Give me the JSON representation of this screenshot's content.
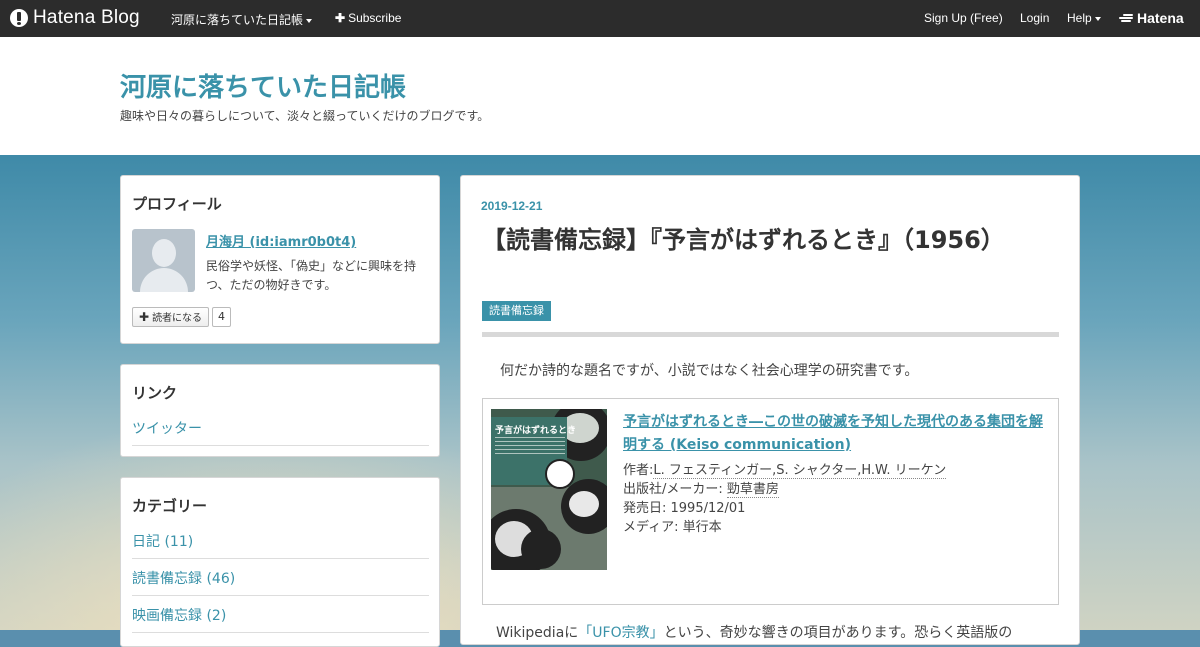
{
  "topbar": {
    "logo": "Hatena Blog",
    "blog_menu": "河原に落ちていた日記帳",
    "subscribe": "Subscribe",
    "signup": "Sign Up (Free)",
    "login": "Login",
    "help": "Help",
    "hatena": "Hatena"
  },
  "header": {
    "title": "河原に落ちていた日記帳",
    "description": "趣味や日々の暮らしについて、淡々と綴っていくだけのブログです。"
  },
  "profile": {
    "heading": "プロフィール",
    "name": "月海月 (id:iamr0b0t4)",
    "bio": "民俗学や妖怪、「偽史」などに興味を持つ、ただの物好きです。",
    "reader_button": "読者になる",
    "reader_count": "4"
  },
  "links": {
    "heading": "リンク",
    "items": [
      {
        "label": "ツイッター"
      }
    ]
  },
  "categories": {
    "heading": "カテゴリー",
    "items": [
      {
        "label": "日記 (11)"
      },
      {
        "label": "読書備忘録 (46)"
      },
      {
        "label": "映画備忘録 (2)"
      }
    ]
  },
  "article": {
    "date": "2019-12-21",
    "title": "【読書備忘録】『予言がはずれるとき』（1956）",
    "tag": "読書備忘録",
    "lead": "何だか詩的な題名ですが、小説ではなく社会心理学の研究書です。",
    "product": {
      "cover_title": "予言がはずれるとき",
      "link": "予言がはずれるとき―この世の破滅を予知した現代のある集団を解明する (Keiso communication)",
      "author_label": "作者:",
      "author": "L. フェスティンガー,S. シャクター,H.W. リーケン",
      "publisher_label": "出版社/メーカー:",
      "publisher": "勁草書房",
      "release": "発売日: 1995/12/01",
      "media": "メディア: 単行本"
    },
    "body_prefix": "Wikipediaに",
    "body_link": "「UFO宗教」",
    "body_suffix": "という、奇妙な響きの項目があります。恐らく英語版の"
  }
}
